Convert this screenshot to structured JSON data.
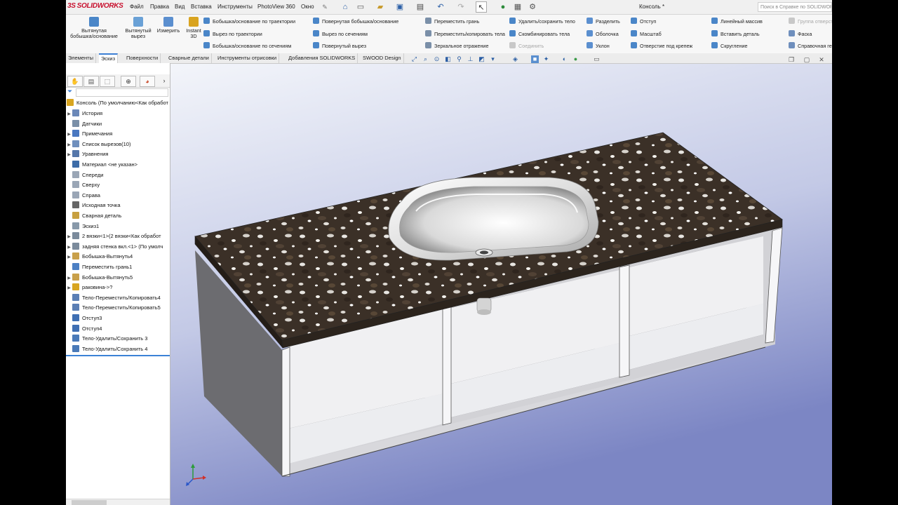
{
  "app": {
    "logo_ds": "3S",
    "logo_text": "SOLIDWORKS",
    "document_title": "Консоль *",
    "help_search_placeholder": "Поиск в Справке по SOLIDWORKS"
  },
  "menu": [
    "Файл",
    "Правка",
    "Вид",
    "Вставка",
    "Инструменты",
    "PhotoView 360",
    "Окно"
  ],
  "ribbon": {
    "big_buttons": [
      {
        "label_line1": "Вытянутая",
        "label_line2": "бобышка/основание",
        "color": "#4a86c8"
      },
      {
        "label_line1": "Вытянутый",
        "label_line2": "вырез",
        "color": "#6aa1d6"
      },
      {
        "label_line1": "Измерить",
        "label_line2": "",
        "color": "#5b8fcf"
      },
      {
        "label_line1": "Instant",
        "label_line2": "3D",
        "color": "#d9a420"
      }
    ],
    "columns": [
      [
        "Бобышка/основание по траектории",
        "Вырез по траектории",
        "Бобышка/основание по сечениям"
      ],
      [
        "Повернутая бобышка/основание",
        "Вырез по сечениям",
        "Повернутый вырез"
      ],
      [
        "Переместить грань",
        "Переместить/копировать тела",
        "Зеркальное отражение"
      ],
      [
        "Удалить/сохранить тело",
        "Скомбинировать тела",
        "Соединить"
      ],
      [
        "Разделить",
        "Оболочка",
        "Уклон"
      ],
      [
        "Отступ",
        "Масштаб",
        "Отверстие под крепеж"
      ],
      [
        "Линейный массив",
        "Вставить деталь",
        "Скругление"
      ],
      [
        "Группа отверстий",
        "Фаска",
        "Справочная геометрия"
      ]
    ],
    "disabled": [
      "Соединить",
      "Группа отверстий"
    ]
  },
  "tabs": [
    "Элементы",
    "Эскиз",
    "Поверхности",
    "Сварные детали",
    "Инструменты отрисовки",
    "Добавления SOLIDWORKS",
    "SWOOD Design"
  ],
  "active_tab": "Эскиз",
  "tree": {
    "root": "Консоль  (По умолчанию<Как обработ",
    "items": [
      {
        "label": "История",
        "expand": true,
        "icon": "history-icon",
        "color": "#6b88b8"
      },
      {
        "label": "Датчики",
        "expand": false,
        "icon": "sensor-icon",
        "color": "#7a8fa8"
      },
      {
        "label": "Примечания",
        "expand": true,
        "icon": "annotation-icon",
        "color": "#4a78c0"
      },
      {
        "label": "Список вырезов(10)",
        "expand": true,
        "icon": "cutlist-icon",
        "color": "#6f8fbd"
      },
      {
        "label": "Уравнения",
        "expand": true,
        "icon": "equation-icon",
        "color": "#5577aa"
      },
      {
        "label": "Материал <не указан>",
        "expand": false,
        "icon": "material-icon",
        "color": "#3d6ca8"
      },
      {
        "label": "Спереди",
        "expand": false,
        "icon": "plane-icon",
        "color": "#9aa6b6"
      },
      {
        "label": "Сверху",
        "expand": false,
        "icon": "plane-icon",
        "color": "#9aa6b6"
      },
      {
        "label": "Справа",
        "expand": false,
        "icon": "plane-icon",
        "color": "#9aa6b6"
      },
      {
        "label": "Исходная точка",
        "expand": false,
        "icon": "origin-icon",
        "color": "#666666"
      },
      {
        "label": "Сварная деталь",
        "expand": false,
        "icon": "weldment-icon",
        "color": "#c8a040"
      },
      {
        "label": "Эскиз1",
        "expand": false,
        "icon": "sketch-icon",
        "color": "#8899aa"
      },
      {
        "label": "2 вязки<1>(2 вязки<Как обработ",
        "expand": true,
        "icon": "structure-icon",
        "color": "#7b8b9c"
      },
      {
        "label": "задняя стенка вкл.<1> (По умолч",
        "expand": true,
        "icon": "structure-icon",
        "color": "#7b8b9c"
      },
      {
        "label": "Бобышка-Вытянуть4",
        "expand": true,
        "icon": "extrude-icon",
        "color": "#c9a04a"
      },
      {
        "label": "Переместить грань1",
        "expand": false,
        "icon": "move-face-icon",
        "color": "#4d80c4"
      },
      {
        "label": "Бобышка-Вытянуть5",
        "expand": true,
        "icon": "extrude-icon",
        "color": "#c9a04a"
      },
      {
        "label": "раковина->?",
        "expand": true,
        "icon": "part-icon",
        "color": "#d8a520"
      },
      {
        "label": "Тело-Переместить/Копировать4",
        "expand": false,
        "icon": "move-body-icon",
        "color": "#5b7fb5"
      },
      {
        "label": "Тело-Переместить/Копировать5",
        "expand": false,
        "icon": "move-body-icon",
        "color": "#5b7fb5"
      },
      {
        "label": "Отступ3",
        "expand": false,
        "icon": "indent-icon",
        "color": "#3f6fb3"
      },
      {
        "label": "Отступ4",
        "expand": false,
        "icon": "indent-icon",
        "color": "#3f6fb3"
      },
      {
        "label": "Тело-Удалить/Сохранить 3",
        "expand": false,
        "icon": "delete-body-icon",
        "color": "#4a7ab8"
      },
      {
        "label": "Тело-Удалить/Сохранить 4",
        "expand": false,
        "icon": "delete-body-icon",
        "color": "#4a7ab8"
      }
    ]
  },
  "colors": {
    "accent": "#3c7fd4",
    "viewport_top": "#f3f5fa",
    "viewport_bottom": "#7c86c4",
    "granite": "#3b3027",
    "cabinet": "#e8e8ea",
    "sink": "#f2f2f2"
  }
}
